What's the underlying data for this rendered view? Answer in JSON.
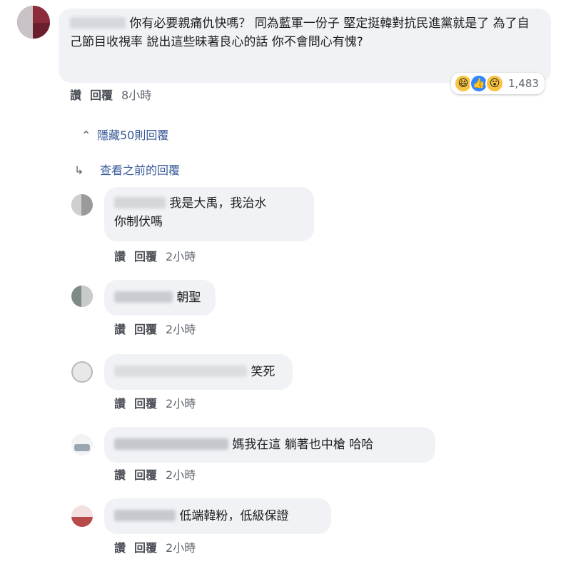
{
  "main_comment": {
    "text": "你有必要親痛仇快嗎？ 同為藍軍一份子 堅定挺韓對抗民進黨就是了 為了自己節目收視率 說出這些昧著良心的話 你不會問心有愧?",
    "reaction_count": "1,483",
    "actions": {
      "like": "讚",
      "reply": "回覆",
      "time": "8小時"
    }
  },
  "thread": {
    "hide_replies": "隱藏50則回覆",
    "view_previous": "查看之前的回覆"
  },
  "replies": [
    {
      "text": "我是大禹，我治水你制伏嗎",
      "line1": "我是大禹，我治水",
      "line2": "你制伏嗎",
      "like": "讚",
      "reply": "回覆",
      "time": "2小時"
    },
    {
      "text": "朝聖",
      "like": "讚",
      "reply": "回覆",
      "time": "2小時"
    },
    {
      "text": "笑死",
      "like": "讚",
      "reply": "回覆",
      "time": "2小時"
    },
    {
      "text": "媽我在這 躺著也中槍 哈哈",
      "like": "讚",
      "reply": "回覆",
      "time": "2小時"
    },
    {
      "text": "低端韓粉，低級保證",
      "like": "讚",
      "reply": "回覆",
      "time": "2小時"
    }
  ],
  "colors": {
    "bubble": "#f0f2f5",
    "link": "#385898",
    "meta": "#606770"
  }
}
